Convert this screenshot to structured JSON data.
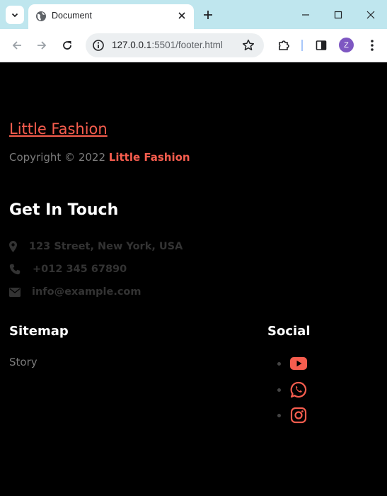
{
  "browser": {
    "tab_title": "Document",
    "url_host": "127.0.0.1",
    "url_path": ":5501/footer.html",
    "profile_initial": "Z"
  },
  "footer": {
    "brand_link": "Little Fashion",
    "copyright_prefix": "Copyright © 2022",
    "copyright_brand": "Little Fashion",
    "contact_heading": "Get In Touch",
    "contact": [
      {
        "icon": "map-marker-icon",
        "text": "123 Street, New York, USA"
      },
      {
        "icon": "phone-icon",
        "text": "+012 345 67890"
      },
      {
        "icon": "envelope-icon",
        "text": "info@example.com"
      }
    ],
    "sitemap_heading": "Sitemap",
    "sitemap_links": [
      "Story"
    ],
    "social_heading": "Social",
    "social": [
      "youtube-icon",
      "whatsapp-icon",
      "instagram-icon"
    ]
  },
  "colors": {
    "accent": "#f65d4e",
    "muted_text": "#7b7b7b",
    "dim_text": "#333333",
    "tabbar": "#bfe6ee"
  }
}
